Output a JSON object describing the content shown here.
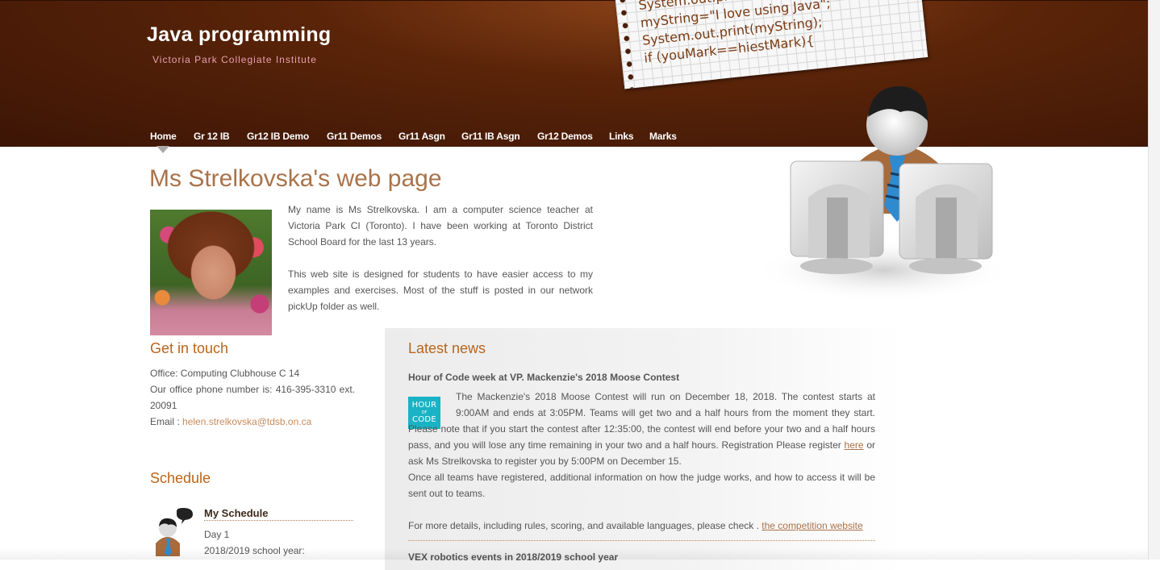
{
  "header": {
    "title": "Java programming",
    "subtitle": "Victoria Park Collegiate Institute",
    "code_note": [
      "System.out.println(",
      "myString=\"I love using Java\";",
      "System.out.print(myString);",
      "if (youMark==hiestMark){"
    ]
  },
  "nav": {
    "items": [
      {
        "label": "Home",
        "active": true
      },
      {
        "label": "Gr 12 IB"
      },
      {
        "label": "Gr12 IB Demo"
      },
      {
        "label": "Gr11 Demos"
      },
      {
        "label": "Gr11 Asgn"
      },
      {
        "label": "Gr11 IB Asgn"
      },
      {
        "label": "Gr12 Demos"
      },
      {
        "label": "Links"
      },
      {
        "label": "Marks"
      }
    ]
  },
  "main": {
    "page_title": "Ms Strelkovska's web page",
    "intro_paragraphs": [
      "My name is Ms Strelkovska. I am a computer science teacher at Victoria Park CI (Toronto). I have been working at Toronto District School Board for the last 13 years.",
      "This web site is designed for students to have easier access to my examples and exercises. Most of the stuff is posted in our network pickUp folder as well."
    ]
  },
  "contact": {
    "heading": "Get in touch",
    "office": "Office: Computing Clubhouse C 14",
    "phone": "Our office phone number is: 416-395-3310 ext. 20091",
    "email_label": "Email : ",
    "email": "helen.strelkovska@tdsb.on.ca"
  },
  "schedule": {
    "heading": "Schedule",
    "title": "My Schedule",
    "day": "Day 1",
    "year": "2018/2019 school year:"
  },
  "news": {
    "heading": "Latest news",
    "item_title": "Hour of Code week at VP. Mackenzie's 2018 Moose Contest",
    "logo_lines": [
      "HOUR",
      "OF",
      "CODE"
    ],
    "p1_before_link": "The Mackenzie's 2018 Moose Contest will run on December 18, 2018. The contest starts at 9:00AM and ends at 3:05PM. Teams will get two and a half hours from the moment they start. Please note that if you start the contest after 12:35:00, the contest will end before your two and a half hours pass, and you will lose any time remaining in your two and a half hours. Registration Please register ",
    "p1_link": "here",
    "p1_after_link": " or ask Ms Strelkovska to register you by 5:00PM on December 15.",
    "p2": "Once all teams have registered, additional information on how the judge works, and how to access it will be sent out to teams.",
    "p3_before_link": "For more details, including rules, scoring, and available languages, please check . ",
    "p3_link": "the competition website",
    "next_item_title": "VEX robotics events in 2018/2019 school year"
  },
  "colors": {
    "header_brown": "#5a2409",
    "heading_brown": "#a9734a",
    "section_orange": "#b9651b",
    "link_tan": "#c98a5a",
    "hoc_teal": "#1ab3c5"
  }
}
